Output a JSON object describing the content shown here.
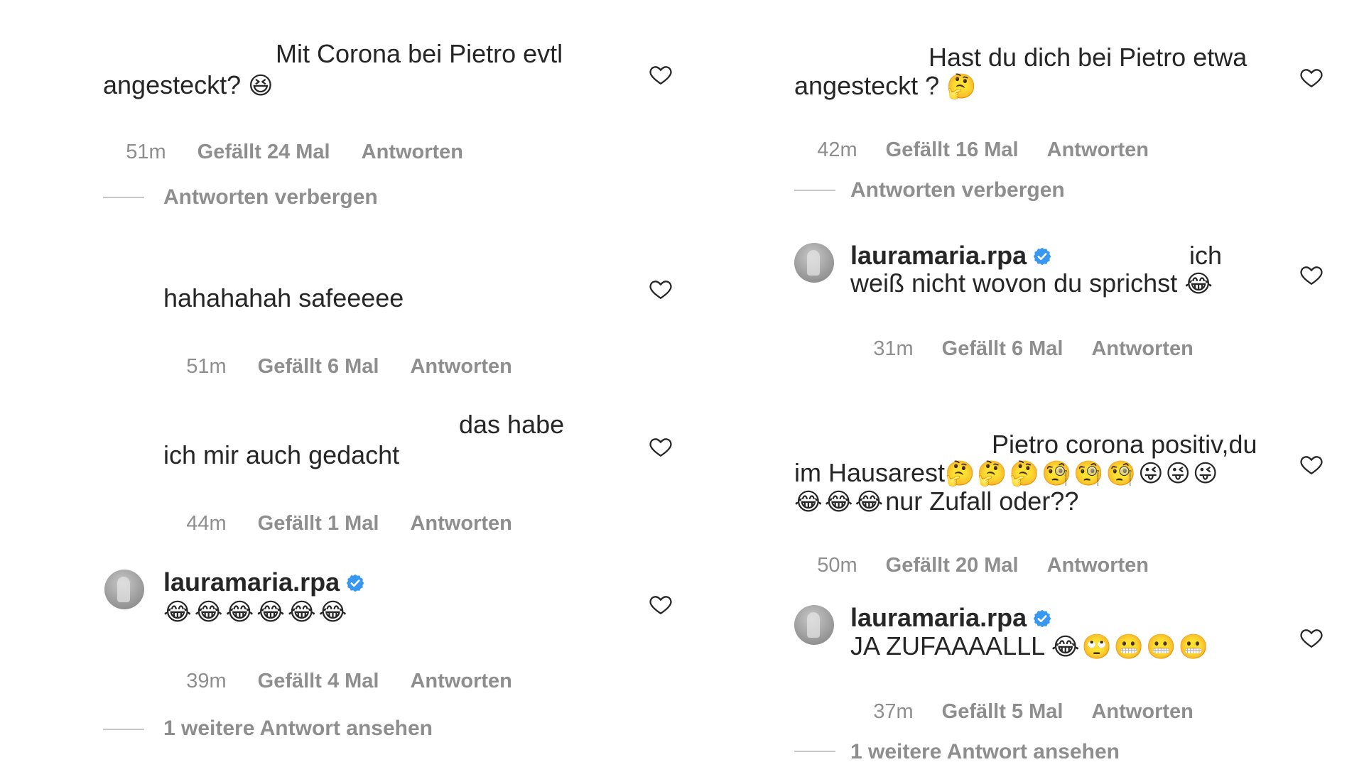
{
  "left": {
    "c1": {
      "text_a": "Mit Corona bei Pietro evtl",
      "text_b": "angesteckt?",
      "emoji": "😆",
      "time": "51m",
      "likes": "Gefällt 24 Mal",
      "reply": "Antworten"
    },
    "hide_replies": "Antworten verbergen",
    "r1": {
      "text": "hahahahah safeeeee",
      "time": "51m",
      "likes": "Gefällt 6 Mal",
      "reply": "Antworten"
    },
    "r2": {
      "text_a": "das habe",
      "text_b": "ich mir auch gedacht",
      "time": "44m",
      "likes": "Gefällt 1 Mal",
      "reply": "Antworten"
    },
    "r3": {
      "username": "lauramaria.rpa",
      "emojis": "😂😂😂😂😂😂",
      "time": "39m",
      "likes": "Gefällt 4 Mal",
      "reply": "Antworten"
    },
    "more_replies": "1 weitere Antwort ansehen"
  },
  "right": {
    "c1": {
      "text_a": "Hast du dich bei Pietro etwa",
      "text_b": "angesteckt ?",
      "emoji": "🤔",
      "time": "42m",
      "likes": "Gefällt 16 Mal",
      "reply": "Antworten"
    },
    "hide_replies": "Antworten verbergen",
    "r1": {
      "username": "lauramaria.rpa",
      "text_a": "ich",
      "text_b": "weiß nicht wovon du sprichst",
      "emoji": "😂",
      "time": "31m",
      "likes": "Gefällt 6 Mal",
      "reply": "Antworten"
    },
    "c2": {
      "text_a": "Pietro corona positiv,du",
      "text_b": "im Hausarest",
      "emojis_b": "🤔🤔🤔🧐🧐🧐😜😜😜",
      "emojis_c": "😂😂😂",
      "text_c": "nur Zufall oder??",
      "time": "50m",
      "likes": "Gefällt 20 Mal",
      "reply": "Antworten"
    },
    "r2": {
      "username": "lauramaria.rpa",
      "text": "JA ZUFAAAALLL",
      "emojis": "😂🙄😬😬😬",
      "time": "37m",
      "likes": "Gefällt 5 Mal",
      "reply": "Antworten"
    },
    "more_replies": "1 weitere Antwort ansehen"
  },
  "icons": {
    "like": "heart-outline-icon",
    "verified": "verified-badge-icon"
  },
  "colors": {
    "text": "#262626",
    "secondary": "#8e8e8e",
    "verified": "#3897f0"
  }
}
